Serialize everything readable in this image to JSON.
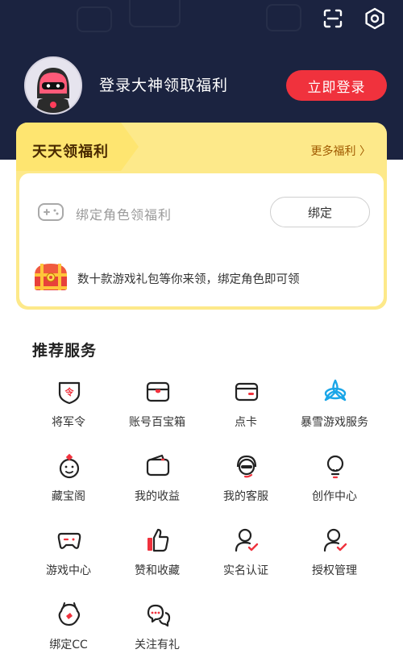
{
  "header": {
    "login_prompt": "登录大神领取福利",
    "login_button": "立即登录"
  },
  "welfare": {
    "title": "天天领福利",
    "more": "更多福利 〉",
    "bind_text": "绑定角色领福利",
    "bind_button": "绑定",
    "gift_text": "数十款游戏礼包等你来领，绑定角色即可领"
  },
  "services": {
    "title": "推荐服务",
    "items": [
      {
        "label": "将军令",
        "icon": "shield-token-icon"
      },
      {
        "label": "账号百宝箱",
        "icon": "treasure-box-icon"
      },
      {
        "label": "点卡",
        "icon": "card-icon"
      },
      {
        "label": "暴雪游戏服务",
        "icon": "blizzard-icon"
      },
      {
        "label": "藏宝阁",
        "icon": "treasure-pavilion-icon"
      },
      {
        "label": "我的收益",
        "icon": "wallet-icon"
      },
      {
        "label": "我的客服",
        "icon": "customer-service-icon"
      },
      {
        "label": "创作中心",
        "icon": "lightbulb-icon"
      },
      {
        "label": "游戏中心",
        "icon": "gamepad-icon"
      },
      {
        "label": "赞和收藏",
        "icon": "thumbs-up-icon"
      },
      {
        "label": "实名认证",
        "icon": "realname-icon"
      },
      {
        "label": "授权管理",
        "icon": "authorization-icon"
      },
      {
        "label": "绑定CC",
        "icon": "cc-icon"
      },
      {
        "label": "关注有礼",
        "icon": "follow-gift-icon"
      }
    ]
  },
  "colors": {
    "header_bg": "#1b2340",
    "accent_red": "#f0323d",
    "welfare_yellow": "#fde98a",
    "blizzard_blue": "#1aa6e8"
  }
}
